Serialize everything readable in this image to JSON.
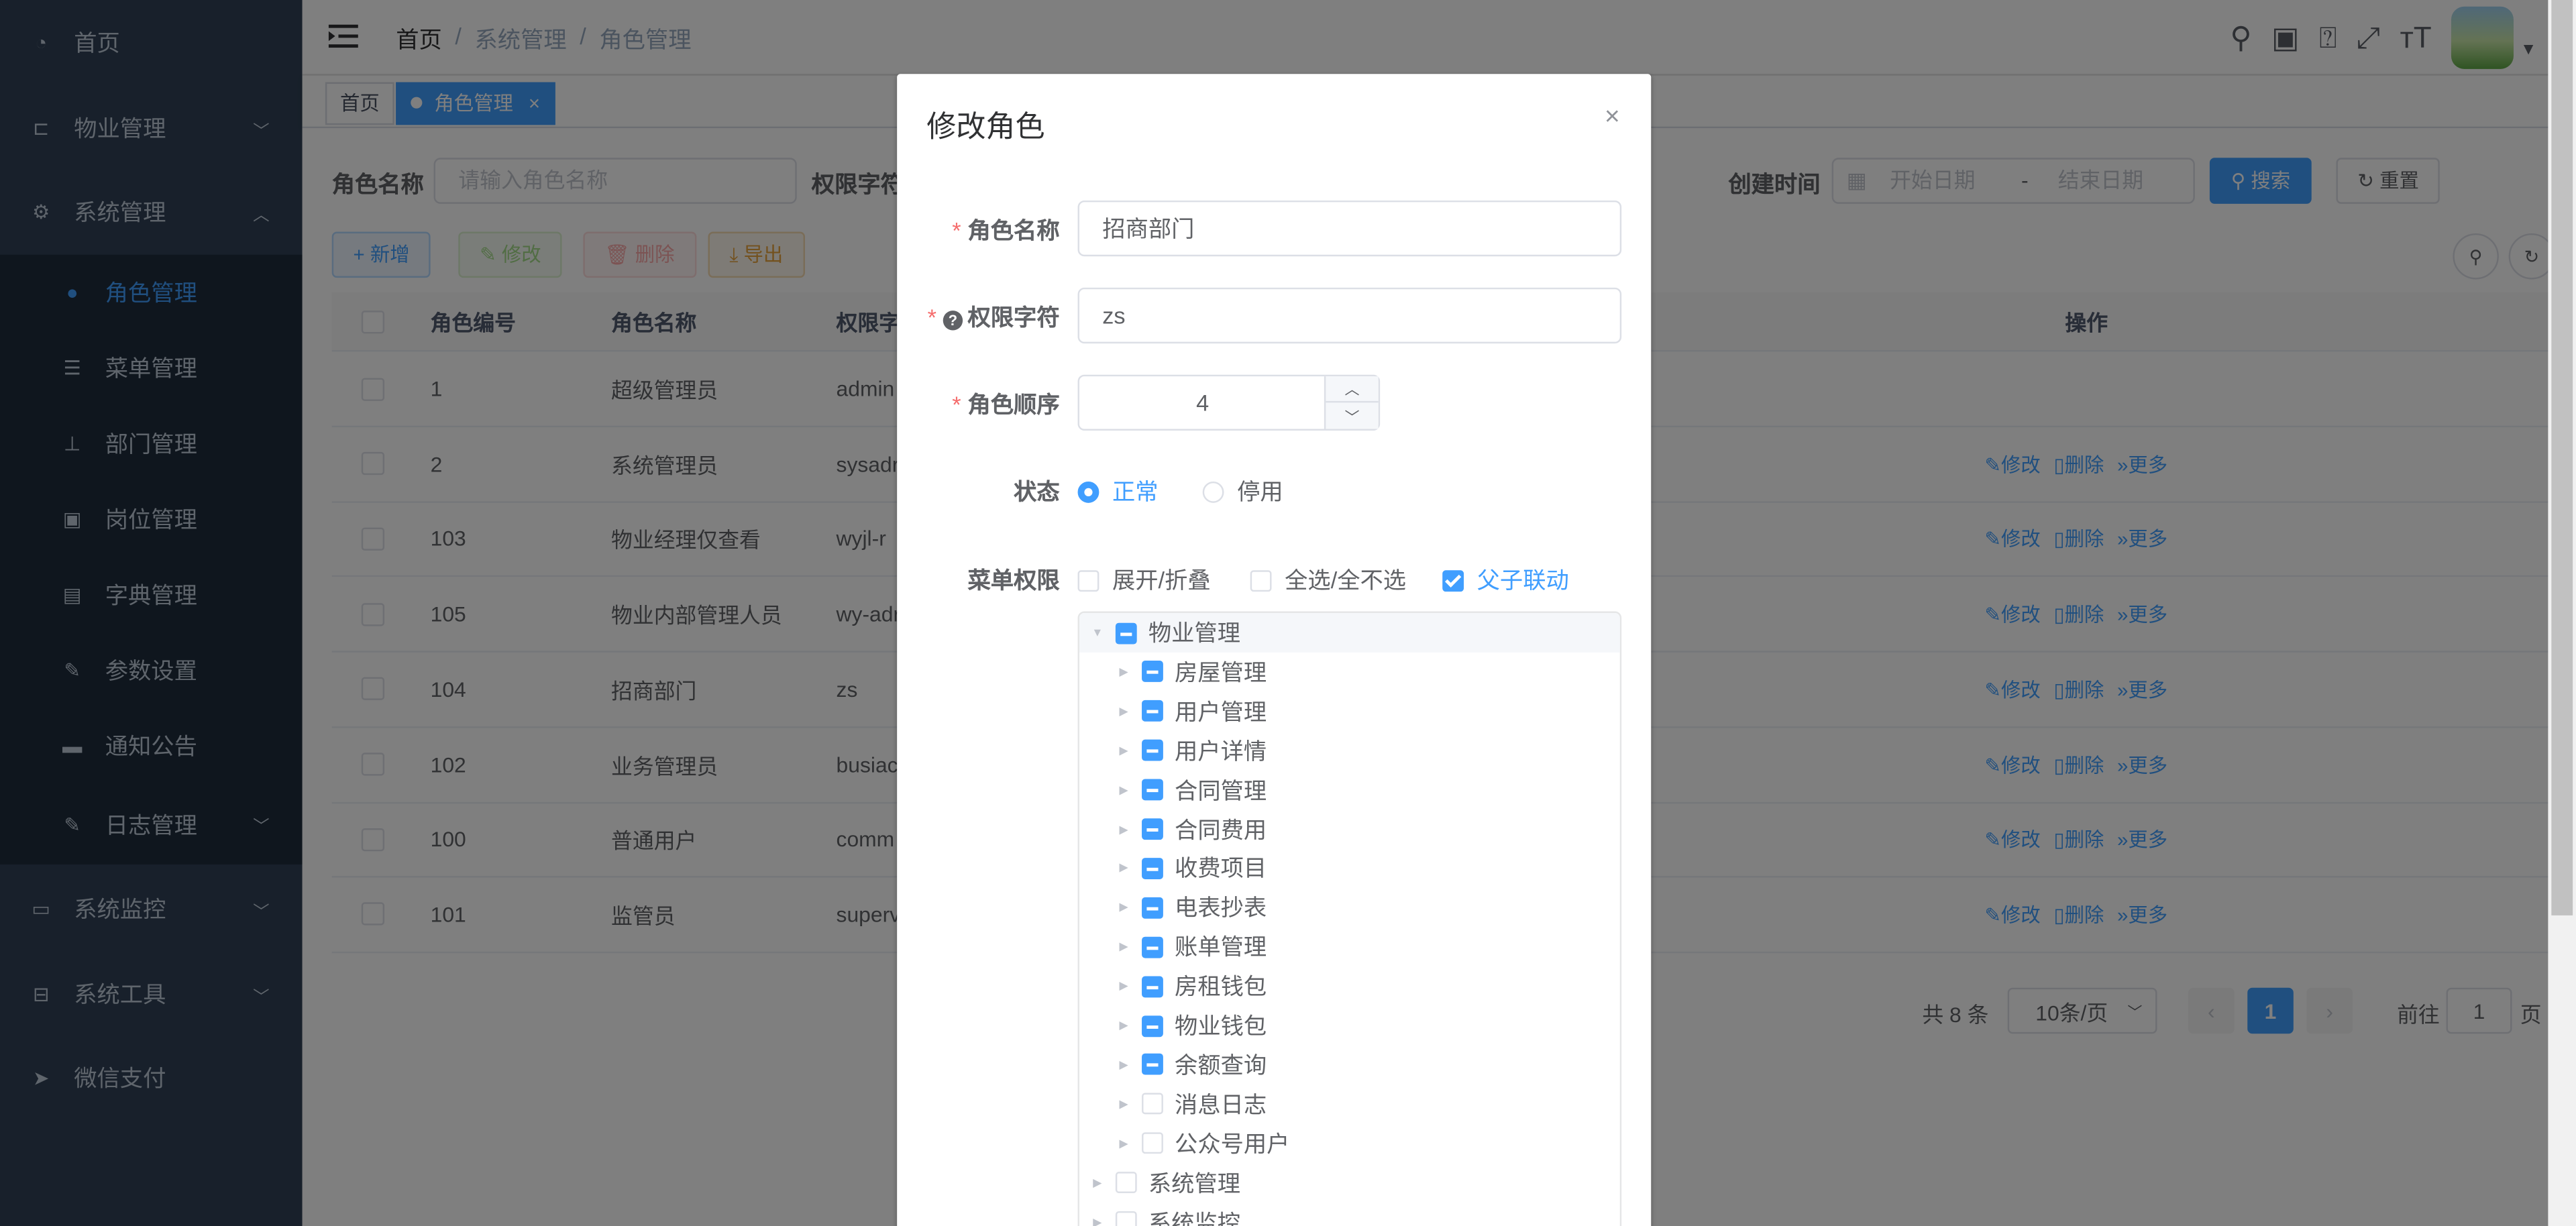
{
  "sidebar": {
    "items": [
      {
        "label": "首页",
        "icon": "dashboard-icon"
      },
      {
        "label": "物业管理",
        "icon": "tree-icon",
        "arrow": "⌄"
      },
      {
        "label": "系统管理",
        "icon": "gear-icon",
        "arrow": "⌃"
      }
    ],
    "sub_items": [
      {
        "label": "角色管理",
        "icon": "user-icon"
      },
      {
        "label": "菜单管理",
        "icon": "list-icon"
      },
      {
        "label": "部门管理",
        "icon": "org-tree-icon"
      },
      {
        "label": "岗位管理",
        "icon": "badge-icon"
      },
      {
        "label": "字典管理",
        "icon": "dictionary-icon"
      },
      {
        "label": "参数设置",
        "icon": "edit-icon"
      },
      {
        "label": "通知公告",
        "icon": "message-icon"
      },
      {
        "label": "日志管理",
        "icon": "log-icon",
        "arrow": "⌄"
      }
    ],
    "bottom_items": [
      {
        "label": "系统监控",
        "icon": "monitor-icon",
        "arrow": "⌄"
      },
      {
        "label": "系统工具",
        "icon": "toolbox-icon",
        "arrow": "⌄"
      },
      {
        "label": "微信支付",
        "icon": "send-icon"
      }
    ]
  },
  "navbar": {
    "breadcrumb": [
      "首页",
      "系统管理",
      "角色管理"
    ],
    "separator": "/"
  },
  "tags": {
    "home": "首页",
    "active": "角色管理",
    "close": "×"
  },
  "query": {
    "role_name_label": "角色名称",
    "role_name_placeholder": "请输入角色名称",
    "perm_label": "权限字符",
    "created_label": "创建时间",
    "start_date_placeholder": "开始日期",
    "date_sep": "-",
    "end_date_placeholder": "结束日期",
    "search_btn": "搜索",
    "reset_btn": "重置"
  },
  "toolbar": {
    "add": "新增",
    "edit": "修改",
    "delete": "删除",
    "export": "导出"
  },
  "table": {
    "headers": [
      "角色编号",
      "角色名称",
      "权限字",
      "操作"
    ],
    "rows": [
      {
        "id": "1",
        "name": "超级管理员",
        "perm": "admin",
        "ops": false
      },
      {
        "id": "2",
        "name": "系统管理员",
        "perm": "sysadr",
        "ops": true
      },
      {
        "id": "103",
        "name": "物业经理仅查看",
        "perm": "wyjl-r",
        "ops": true
      },
      {
        "id": "105",
        "name": "物业内部管理人员",
        "perm": "wy-adr",
        "ops": true
      },
      {
        "id": "104",
        "name": "招商部门",
        "perm": "zs",
        "ops": true
      },
      {
        "id": "102",
        "name": "业务管理员",
        "perm": "busiac",
        "ops": true
      },
      {
        "id": "100",
        "name": "普通用户",
        "perm": "comm",
        "ops": true
      },
      {
        "id": "101",
        "name": "监管员",
        "perm": "superv",
        "ops": true
      }
    ],
    "op_edit": "修改",
    "op_delete": "删除",
    "op_more": "更多"
  },
  "pagination": {
    "total": "共 8 条",
    "page_size": "10条/页",
    "current": "1",
    "goto_label": "前往",
    "goto_value": "1",
    "page_unit": "页"
  },
  "dialog": {
    "title": "修改角色",
    "close": "×",
    "fields": {
      "role_name_label": "角色名称",
      "role_name_value": "招商部门",
      "perm_label": "权限字符",
      "perm_value": "zs",
      "order_label": "角色顺序",
      "order_value": "4",
      "status_label": "状态",
      "status_normal": "正常",
      "status_disabled": "停用",
      "menu_perm_label": "菜单权限",
      "expand_collapse": "展开/折叠",
      "select_all": "全选/全不选",
      "parent_child_link": "父子联动"
    },
    "tree": [
      {
        "label": "物业管理",
        "level": 0,
        "expanded": true,
        "state": "indeterminate"
      },
      {
        "label": "房屋管理",
        "level": 1,
        "state": "indeterminate"
      },
      {
        "label": "用户管理",
        "level": 1,
        "state": "indeterminate"
      },
      {
        "label": "用户详情",
        "level": 1,
        "state": "indeterminate"
      },
      {
        "label": "合同管理",
        "level": 1,
        "state": "indeterminate"
      },
      {
        "label": "合同费用",
        "level": 1,
        "state": "indeterminate"
      },
      {
        "label": "收费项目",
        "level": 1,
        "state": "indeterminate"
      },
      {
        "label": "电表抄表",
        "level": 1,
        "state": "indeterminate"
      },
      {
        "label": "账单管理",
        "level": 1,
        "state": "indeterminate"
      },
      {
        "label": "房租钱包",
        "level": 1,
        "state": "indeterminate"
      },
      {
        "label": "物业钱包",
        "level": 1,
        "state": "indeterminate"
      },
      {
        "label": "余额查询",
        "level": 1,
        "state": "indeterminate"
      },
      {
        "label": "消息日志",
        "level": 1,
        "state": "unchecked"
      },
      {
        "label": "公众号用户",
        "level": 1,
        "state": "unchecked"
      },
      {
        "label": "系统管理",
        "level": 0,
        "state": "unchecked"
      },
      {
        "label": "系统监控",
        "level": 0,
        "state": "unchecked"
      }
    ]
  },
  "colors": {
    "primary": "#409eff",
    "sidebar_bg": "#304156",
    "submenu_bg": "#1f2d3d",
    "danger": "#f56c6c"
  }
}
